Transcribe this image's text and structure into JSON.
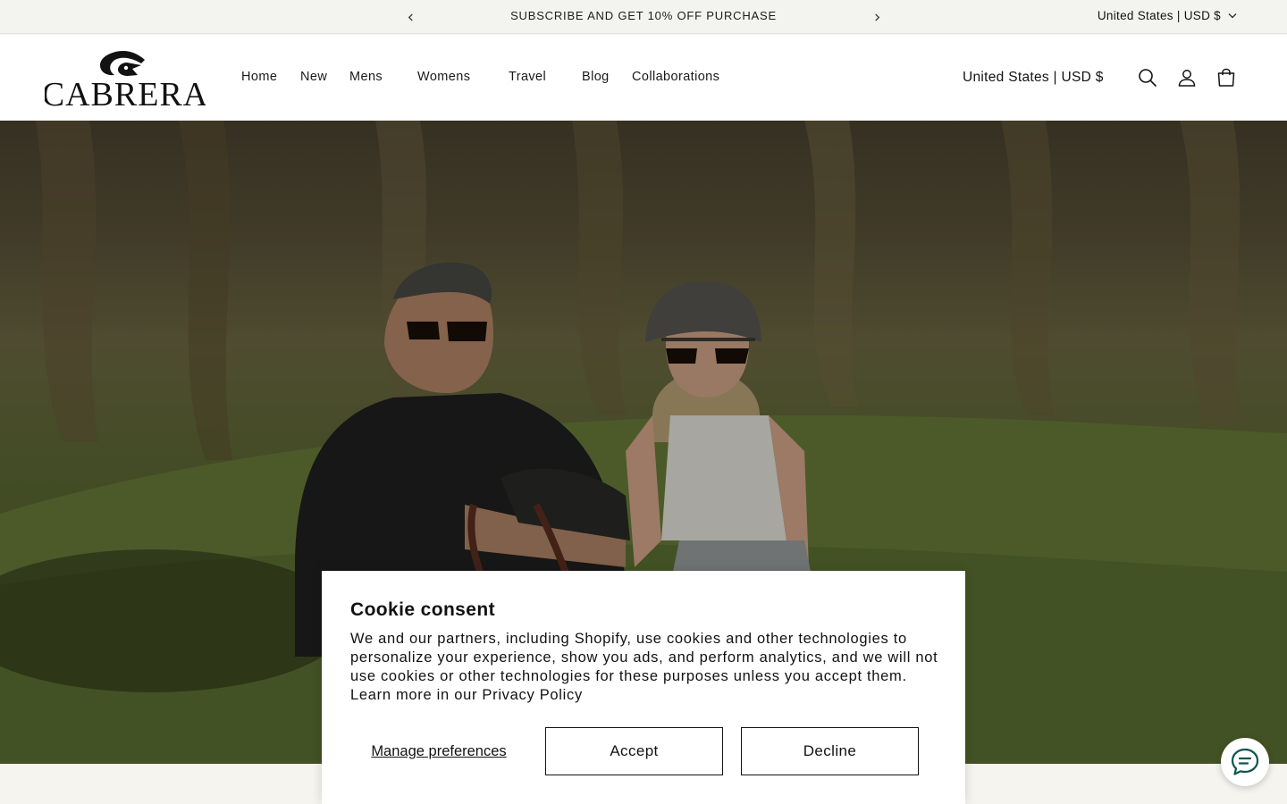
{
  "announcement": {
    "message": "SUBSCRIBE AND GET 10% OFF PURCHASE",
    "prev_icon": "chevron-left-icon",
    "next_icon": "chevron-right-icon",
    "locale": "United States | USD $"
  },
  "header": {
    "logo_text": "CABRERA",
    "nav": [
      {
        "label": "Home"
      },
      {
        "label": "New"
      },
      {
        "label": "Mens"
      },
      {
        "label": "Womens"
      },
      {
        "label": "Travel"
      },
      {
        "label": "Blog"
      },
      {
        "label": "Collaborations"
      }
    ],
    "locale": "United States | USD $",
    "icons": [
      "search-icon",
      "account-icon",
      "cart-icon"
    ]
  },
  "hero": {
    "image": "man-and-woman-wearing-sunglasses-sitting-on-grass"
  },
  "cookie": {
    "title": "Cookie consent",
    "body": "We and our partners, including Shopify, use cookies and other technologies to personalize your experience, show you ads, and perform analytics, and we will not use cookies or other technologies for these purposes unless you accept them. Learn more in our Privacy Policy",
    "manage_label": "Manage preferences",
    "accept_label": "Accept",
    "decline_label": "Decline"
  },
  "chat": {
    "icon": "chat-bubble-icon",
    "accent": "#0f5550"
  }
}
